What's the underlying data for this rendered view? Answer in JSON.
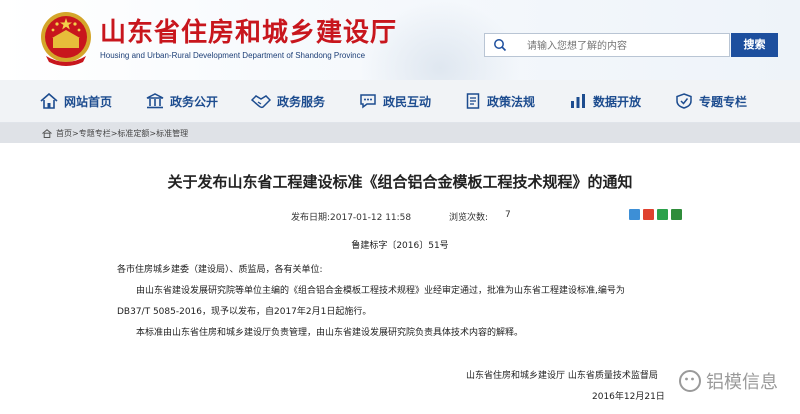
{
  "header": {
    "title": "山东省住房和城乡建设厅",
    "subtitle": "Housing and Urban-Rural Development Department of Shandong Province",
    "search": {
      "placeholder": "请输入您想了解的内容",
      "button_label": "搜索"
    }
  },
  "nav": {
    "items": [
      {
        "label": "网站首页",
        "icon": "home-icon"
      },
      {
        "label": "政务公开",
        "icon": "building-icon"
      },
      {
        "label": "政务服务",
        "icon": "handshake-icon"
      },
      {
        "label": "政民互动",
        "icon": "chat-icon"
      },
      {
        "label": "政策法规",
        "icon": "document-icon"
      },
      {
        "label": "数据开放",
        "icon": "bar-chart-icon"
      },
      {
        "label": "专题专栏",
        "icon": "shield-icon"
      }
    ]
  },
  "breadcrumb": {
    "items": [
      "首页",
      "专题专栏",
      "标准定额",
      "标准管理"
    ],
    "separator": ">"
  },
  "article": {
    "title": "关于发布山东省工程建设标准《组合铝合金模板工程技术规程》的通知",
    "publish_date": "发布日期:2017-01-12 11:58",
    "views_label": "浏览次数:",
    "views_value": "7",
    "doc_number": "鲁建标字〔2016〕51号",
    "salutation": "各市住房城乡建委（建设局）、质监局，各有关单位:",
    "body_line1": "由山东省建设发展研究院等单位主编的《组合铝合金模板工程技术规程》业经审定通过，批准为山东省工程建设标准,编号为",
    "body_line2": "DB37/T 5085-2016，现予以发布，自2017年2月1日起施行。",
    "body_line3": "本标准由山东省住房和城乡建设厅负责管理，由山东省建设发展研究院负责具体技术内容的解释。",
    "signature_org": "山东省住房和城乡建设厅   山东省质量技术监督局",
    "signature_date": "2016年12月21日"
  },
  "share_icons": [
    "qzone-icon",
    "weibo-icon",
    "wechat-icon",
    "douban-icon"
  ],
  "watermark": "铝模信息",
  "colors": {
    "title_red": "#c8161d",
    "nav_blue": "#1d4c8f",
    "search_button": "#1d4f9e",
    "breadcrumb_bg": "#dfe2e7"
  }
}
